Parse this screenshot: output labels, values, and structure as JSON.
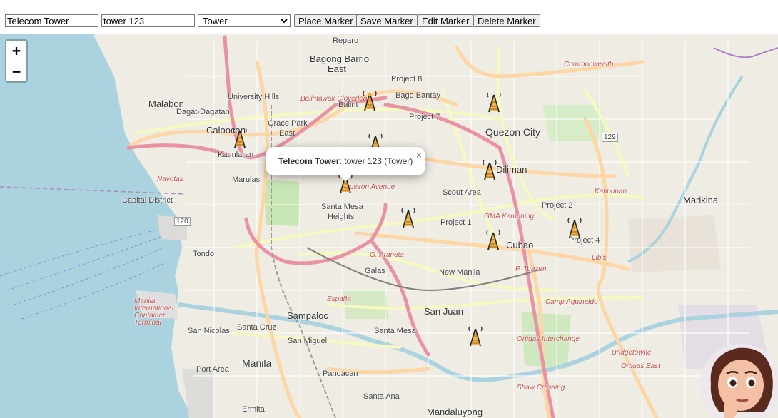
{
  "toolbar": {
    "name_value": "Telecom Tower",
    "desc_value": "tower 123",
    "type_selected": "Tower",
    "place_label": "Place Marker",
    "save_label": "Save Marker",
    "edit_label": "Edit Marker",
    "delete_label": "Delete Marker"
  },
  "zoom": {
    "in_label": "+",
    "out_label": "−"
  },
  "popup": {
    "title": "Telecom Tower",
    "body": ": tower 123 (Tower)",
    "close": "×"
  },
  "map_labels": {
    "reparo": "Reparo",
    "bagong_barrio": "Bagong Barrio",
    "east": "East",
    "project8": "Project 8",
    "malabon": "Malabon",
    "university_hills": "University Hills",
    "bago_bantay": "Bago Bantay",
    "dagat": "Dagat-Dagatan",
    "caloocan": "Caloocan",
    "grace_park": "Grace Park",
    "grace_park_east": "East",
    "balintawak": "Balintawak Cloverleaf",
    "project7": "Project 7",
    "quezon_city": "Quezon City",
    "balint": "Balint",
    "kaunlaran": "Kaunlaran",
    "marulas": "Marulas",
    "diliman": "Diliman",
    "capital_district": "Capital District",
    "scout_area": "Scout Area",
    "marikina": "Marikina",
    "santa_mesa_heights": "Santa Mesa",
    "heights": "Heights",
    "project2": "Project 2",
    "project1": "Project 1",
    "cubao": "Cubao",
    "project4": "Project 4",
    "tondo": "Tondo",
    "galas": "Galas",
    "new_manila": "New Manila",
    "sampaloc": "Sampaloc",
    "san_juan": "San Juan",
    "san_nicolas": "San Nicolas",
    "santa_cruz": "Santa Cruz",
    "santa_mesa": "Santa Mesa",
    "san_miguel": "San Miguel",
    "port_area": "Port Area",
    "manila": "Manila",
    "pandacan": "Pandacan",
    "santa_ana": "Santa Ana",
    "mandaluyong": "Mandaluyong",
    "ermita": "Ermita",
    "commonwealth": "Commonwealth",
    "katipunan": "Katipunan",
    "navotas": "Navotas",
    "gma_kamuning": "GMA Kamuning",
    "libis": "Libis",
    "camp_aguinaldo": "Camp Aguinaldo",
    "ortigas_interchange": "Ortigas Interchange",
    "bridgetowne": "Bridgetowne",
    "ortigas_east": "Ortigas East",
    "shaw_crossing": "Shaw Crossing",
    "p_tuazon": "P. Tuazon",
    "quezon_avenue": "Quezon Avenue",
    "g_araneta": "G. Araneta",
    "espana": "España",
    "road_120": "120",
    "road_129": "129",
    "mia": "Manila International Container Terminal"
  }
}
